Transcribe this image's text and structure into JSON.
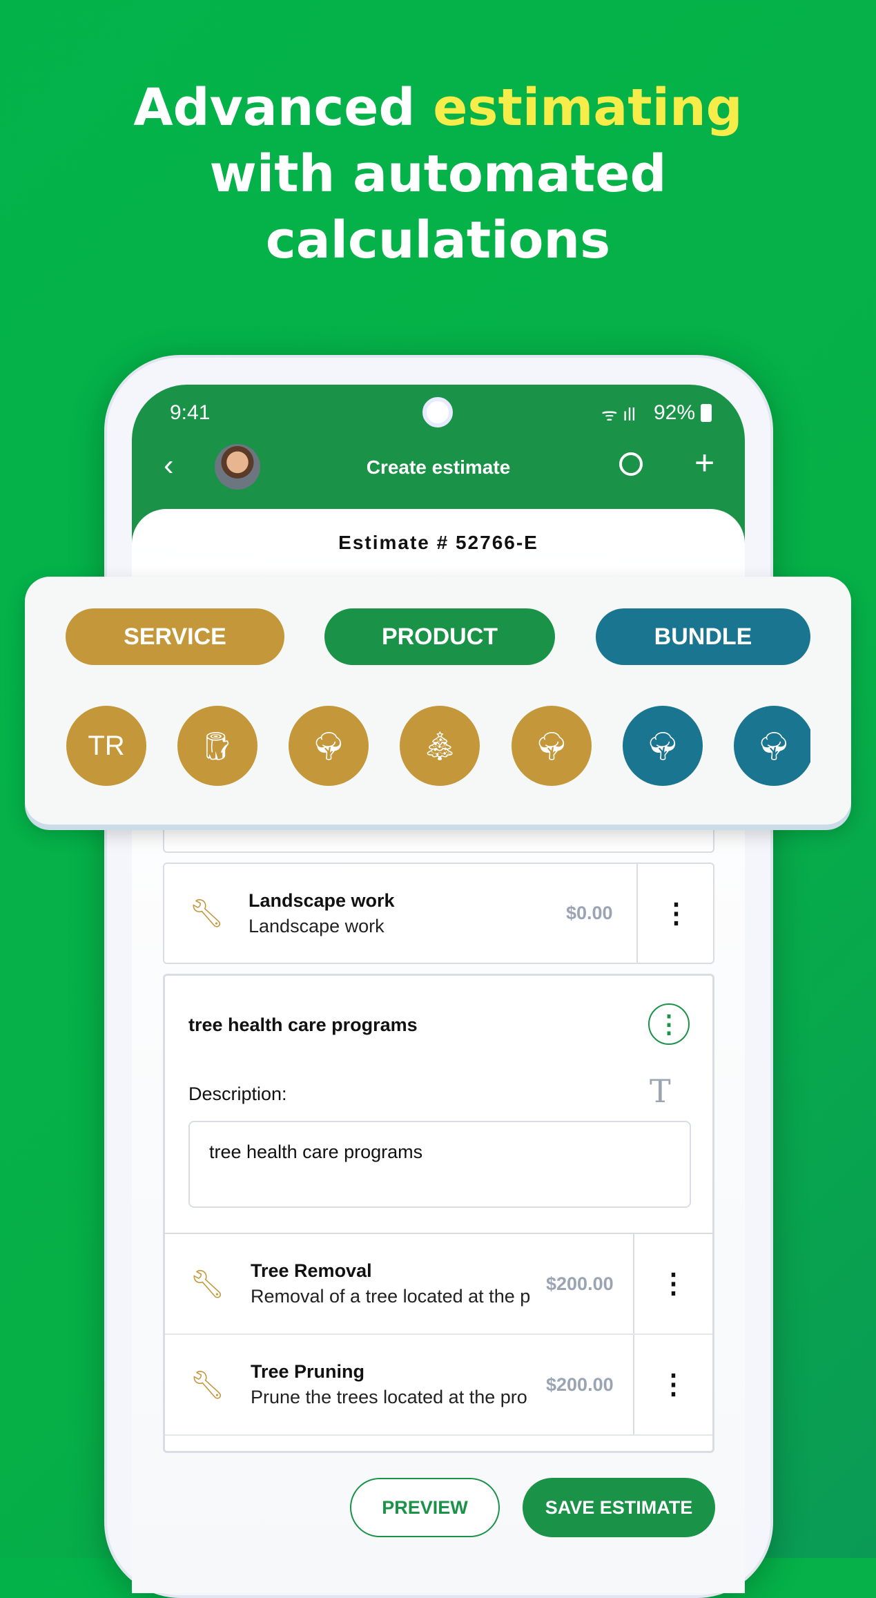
{
  "headline": {
    "part1": "Advanced ",
    "highlight": "estimating",
    "line2": "with automated",
    "line3": "calculations"
  },
  "status_bar": {
    "time": "9:41",
    "battery": "92%"
  },
  "header": {
    "title": "Create estimate"
  },
  "estimate": {
    "number": "Estimate # 52766-E"
  },
  "categories": {
    "service": "SERVICE",
    "product": "PRODUCT",
    "bundle": "BUNDLE"
  },
  "quick_items": [
    {
      "label": "TR",
      "color": "gold"
    },
    {
      "icon": "stump-icon",
      "color": "gold"
    },
    {
      "icon": "tree-planting-icon",
      "color": "gold"
    },
    {
      "icon": "christmas-tree-icon",
      "color": "gold"
    },
    {
      "icon": "tree-pruning-icon",
      "color": "gold"
    },
    {
      "icon": "tree-planting-icon",
      "color": "blue"
    },
    {
      "icon": "tree-cutting-icon",
      "color": "blue"
    }
  ],
  "items": [
    {
      "title": "Landscape work",
      "description": "Landscape work",
      "price": "$0.00"
    }
  ],
  "group": {
    "title": "tree health care programs",
    "description_label": "Description:",
    "description_value": "tree health care programs",
    "items": [
      {
        "title": "Tree Removal",
        "description": "Removal of a tree located at the p",
        "price": "$200.00"
      },
      {
        "title": "Tree Pruning",
        "description": "Prune the trees located at the pro",
        "price": "$200.00"
      }
    ]
  },
  "actions": {
    "preview": "PREVIEW",
    "save": "SAVE ESTIMATE"
  },
  "colors": {
    "service": "#c4973b",
    "product": "#1a9248",
    "bundle": "#1a7591",
    "highlight": "#f6ec4a"
  }
}
